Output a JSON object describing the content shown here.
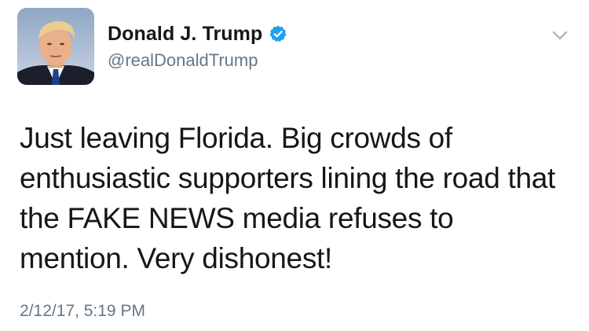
{
  "user": {
    "display_name": "Donald J. Trump",
    "handle": "@realDonaldTrump",
    "verified": true
  },
  "tweet": {
    "text": "Just leaving Florida. Big crowds of enthusiastic supporters lining the road that the FAKE NEWS media refuses to mention. Very dishonest!",
    "timestamp": "2/12/17, 5:19 PM"
  },
  "icons": {
    "avatar": "profile-photo",
    "verified": "verified-badge-icon",
    "menu": "chevron-down-icon"
  },
  "colors": {
    "text_primary": "#14171a",
    "text_secondary": "#657786",
    "verified_blue": "#1da1f2"
  }
}
